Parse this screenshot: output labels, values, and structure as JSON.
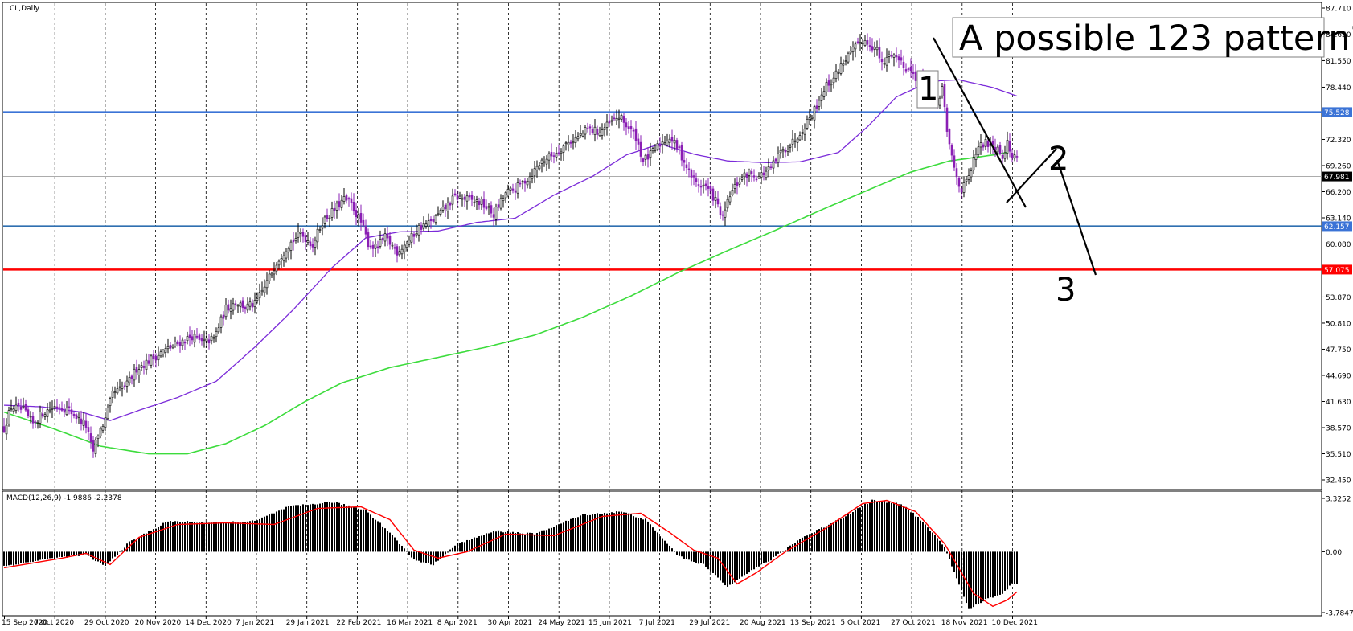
{
  "window": {
    "symbol_label": "CL,Daily",
    "macd_label": "MACD(12,26,9) -1.9886 -2.2378"
  },
  "annotations": {
    "title": "A possible 123 pattern?",
    "label_1": "1",
    "label_2": "2",
    "label_3": "3"
  },
  "colors": {
    "bull": "#000000",
    "bear": "#8a1fb5",
    "ma50": "#7b2bd9",
    "ma200": "#3ddc3d",
    "resistance": "#3b73d6",
    "support": "#2f6fb0",
    "target": "#ff0000",
    "macd_signal": "#ff0000",
    "grid": "#000000"
  },
  "chart_data": {
    "type": "candlestick",
    "price_axis": {
      "min": 32.45,
      "max": 87.71,
      "ticks": [
        "87.710",
        "84.650",
        "81.550",
        "78.440",
        "75.528",
        "72.320",
        "69.260",
        "67.981",
        "66.200",
        "63.140",
        "62.157",
        "60.080",
        "57.075",
        "53.870",
        "50.810",
        "47.750",
        "44.690",
        "41.630",
        "38.570",
        "35.510",
        "32.450"
      ],
      "tick_values": [
        87.71,
        84.65,
        81.55,
        78.44,
        75.528,
        72.32,
        69.26,
        67.981,
        66.2,
        63.14,
        62.157,
        60.08,
        57.075,
        53.87,
        50.81,
        47.75,
        44.69,
        41.63,
        38.57,
        35.51,
        32.45
      ]
    },
    "date_labels": [
      "15 Sep 2020",
      "7 Oct 2020",
      "29 Oct 2020",
      "20 Nov 2020",
      "14 Dec 2020",
      "7 Jan 2021",
      "29 Jan 2021",
      "22 Feb 2021",
      "16 Mar 2021",
      "8 Apr 2021",
      "30 Apr 2021",
      "24 May 2021",
      "15 Jun 2021",
      "7 Jul 2021",
      "29 Jul 2021",
      "20 Aug 2021",
      "13 Sep 2021",
      "5 Oct 2021",
      "27 Oct 2021",
      "18 Nov 2021",
      "10 Dec 2021"
    ],
    "horizontal_levels": [
      {
        "value": 75.528,
        "label": "75.528",
        "role": "resistance"
      },
      {
        "value": 62.157,
        "label": "62.157",
        "role": "support"
      },
      {
        "value": 57.075,
        "label": "57.075",
        "role": "target"
      },
      {
        "value": 67.981,
        "label": "67.981",
        "role": "current"
      }
    ],
    "price_anchors": [
      [
        0,
        38.5
      ],
      [
        3,
        41.0
      ],
      [
        8,
        40.6
      ],
      [
        12,
        39.0
      ],
      [
        16,
        40.3
      ],
      [
        22,
        41.2
      ],
      [
        27,
        40.6
      ],
      [
        31,
        39.6
      ],
      [
        34,
        38.8
      ],
      [
        36,
        36.5
      ],
      [
        37,
        35.8
      ],
      [
        39,
        37.8
      ],
      [
        42,
        39.5
      ],
      [
        45,
        42.5
      ],
      [
        48,
        43.0
      ],
      [
        51,
        43.6
      ],
      [
        55,
        45.5
      ],
      [
        60,
        46.4
      ],
      [
        66,
        47.5
      ],
      [
        72,
        48.4
      ],
      [
        78,
        49.3
      ],
      [
        82,
        48.5
      ],
      [
        87,
        49.0
      ],
      [
        92,
        52.5
      ],
      [
        96,
        53.3
      ],
      [
        100,
        52.7
      ],
      [
        104,
        53.0
      ],
      [
        108,
        55.0
      ],
      [
        113,
        58.0
      ],
      [
        118,
        60.0
      ],
      [
        123,
        61.3
      ],
      [
        128,
        60.0
      ],
      [
        132,
        62.7
      ],
      [
        136,
        63.8
      ],
      [
        141,
        65.3
      ],
      [
        144,
        64.7
      ],
      [
        148,
        62.6
      ],
      [
        151,
        60.2
      ],
      [
        154,
        59.6
      ],
      [
        158,
        60.8
      ],
      [
        163,
        59.2
      ],
      [
        168,
        60.5
      ],
      [
        172,
        62.0
      ],
      [
        177,
        62.6
      ],
      [
        182,
        64.0
      ],
      [
        187,
        65.6
      ],
      [
        192,
        65.3
      ],
      [
        198,
        64.9
      ],
      [
        203,
        63.5
      ],
      [
        208,
        66.0
      ],
      [
        212,
        66.5
      ],
      [
        218,
        68.0
      ],
      [
        223,
        69.8
      ],
      [
        228,
        70.6
      ],
      [
        233,
        71.8
      ],
      [
        238,
        72.6
      ],
      [
        242,
        73.5
      ],
      [
        247,
        73.2
      ],
      [
        250,
        73.9
      ],
      [
        255,
        75.0
      ],
      [
        258,
        74.0
      ],
      [
        262,
        72.6
      ],
      [
        265,
        69.8
      ],
      [
        268,
        70.5
      ],
      [
        272,
        71.8
      ],
      [
        276,
        72.6
      ],
      [
        280,
        71.0
      ],
      [
        284,
        68.5
      ],
      [
        287,
        67.2
      ],
      [
        291,
        66.8
      ],
      [
        295,
        65.2
      ],
      [
        298,
        63.0
      ],
      [
        301,
        65.8
      ],
      [
        305,
        67.6
      ],
      [
        309,
        68.4
      ],
      [
        313,
        68.0
      ],
      [
        318,
        68.9
      ],
      [
        322,
        70.8
      ],
      [
        327,
        72.0
      ],
      [
        332,
        74.0
      ],
      [
        336,
        75.8
      ],
      [
        340,
        78.3
      ],
      [
        344,
        79.5
      ],
      [
        348,
        81.5
      ],
      [
        352,
        82.7
      ],
      [
        356,
        84.0
      ],
      [
        359,
        83.5
      ],
      [
        362,
        82.8
      ],
      [
        364,
        81.0
      ],
      [
        368,
        82.5
      ],
      [
        372,
        81.4
      ],
      [
        377,
        80.0
      ],
      [
        381,
        78.6
      ],
      [
        385,
        78.0
      ],
      [
        387,
        76.5
      ],
      [
        389,
        78.4
      ],
      [
        391,
        73.0
      ],
      [
        394,
        69.0
      ],
      [
        397,
        66.3
      ],
      [
        400,
        67.8
      ],
      [
        403,
        70.8
      ],
      [
        406,
        71.8
      ],
      [
        409,
        72.0
      ],
      [
        412,
        71.4
      ],
      [
        414,
        70.5
      ],
      [
        416,
        71.9
      ],
      [
        418,
        70.2
      ],
      [
        420,
        70.4
      ]
    ],
    "ma50_anchors": [
      [
        0,
        41.2
      ],
      [
        16,
        41.0
      ],
      [
        32,
        40.4
      ],
      [
        44,
        39.4
      ],
      [
        56,
        40.6
      ],
      [
        72,
        42.1
      ],
      [
        88,
        44.0
      ],
      [
        104,
        48.0
      ],
      [
        120,
        52.4
      ],
      [
        136,
        57.3
      ],
      [
        150,
        60.8
      ],
      [
        164,
        61.5
      ],
      [
        180,
        61.6
      ],
      [
        196,
        62.6
      ],
      [
        212,
        63.1
      ],
      [
        228,
        65.8
      ],
      [
        244,
        68.0
      ],
      [
        258,
        70.5
      ],
      [
        272,
        71.8
      ],
      [
        286,
        70.6
      ],
      [
        300,
        69.8
      ],
      [
        316,
        69.6
      ],
      [
        330,
        69.7
      ],
      [
        346,
        70.8
      ],
      [
        358,
        73.8
      ],
      [
        370,
        77.3
      ],
      [
        380,
        78.6
      ],
      [
        388,
        79.2
      ],
      [
        396,
        79.3
      ],
      [
        410,
        78.4
      ],
      [
        420,
        77.4
      ]
    ],
    "ma200_anchors": [
      [
        0,
        40.4
      ],
      [
        20,
        38.5
      ],
      [
        40,
        36.4
      ],
      [
        60,
        35.5
      ],
      [
        76,
        35.5
      ],
      [
        92,
        36.7
      ],
      [
        108,
        38.8
      ],
      [
        124,
        41.5
      ],
      [
        140,
        43.8
      ],
      [
        160,
        45.6
      ],
      [
        180,
        46.8
      ],
      [
        200,
        48.0
      ],
      [
        220,
        49.4
      ],
      [
        240,
        51.5
      ],
      [
        260,
        54.0
      ],
      [
        280,
        56.8
      ],
      [
        300,
        59.3
      ],
      [
        320,
        61.7
      ],
      [
        340,
        64.2
      ],
      [
        360,
        66.6
      ],
      [
        376,
        68.5
      ],
      [
        392,
        69.8
      ],
      [
        410,
        70.5
      ],
      [
        416,
        70.8
      ]
    ],
    "macd_axis": {
      "min": -3.7847,
      "max": 3.3252,
      "ticks": [
        "3.3252",
        "0.00",
        "-3.7847"
      ],
      "tick_values": [
        3.3252,
        0,
        -3.7847
      ]
    },
    "macd_anchors": [
      [
        0,
        -0.9
      ],
      [
        20,
        -0.4
      ],
      [
        34,
        -0.2
      ],
      [
        42,
        -0.9
      ],
      [
        52,
        0.6
      ],
      [
        68,
        1.9
      ],
      [
        88,
        1.8
      ],
      [
        104,
        1.9
      ],
      [
        118,
        2.8
      ],
      [
        136,
        3.1
      ],
      [
        150,
        2.6
      ],
      [
        160,
        1.2
      ],
      [
        170,
        -0.5
      ],
      [
        178,
        -0.8
      ],
      [
        188,
        0.5
      ],
      [
        204,
        1.3
      ],
      [
        220,
        1.1
      ],
      [
        240,
        2.3
      ],
      [
        256,
        2.5
      ],
      [
        266,
        2.0
      ],
      [
        272,
        1.0
      ],
      [
        280,
        -0.3
      ],
      [
        290,
        -0.8
      ],
      [
        300,
        -2.2
      ],
      [
        306,
        -1.5
      ],
      [
        318,
        -0.5
      ],
      [
        330,
        0.8
      ],
      [
        346,
        2.0
      ],
      [
        360,
        3.2
      ],
      [
        372,
        3.0
      ],
      [
        380,
        2.0
      ],
      [
        390,
        0.3
      ],
      [
        400,
        -3.6
      ],
      [
        408,
        -2.9
      ],
      [
        414,
        -2.6
      ],
      [
        418,
        -2.0
      ]
    ],
    "signal_anchors": [
      [
        0,
        -1.0
      ],
      [
        24,
        -0.4
      ],
      [
        34,
        -0.1
      ],
      [
        44,
        -0.8
      ],
      [
        56,
        0.9
      ],
      [
        72,
        1.7
      ],
      [
        92,
        1.8
      ],
      [
        112,
        1.7
      ],
      [
        130,
        2.7
      ],
      [
        148,
        2.8
      ],
      [
        160,
        2.0
      ],
      [
        170,
        0.1
      ],
      [
        180,
        -0.4
      ],
      [
        192,
        0.0
      ],
      [
        208,
        1.1
      ],
      [
        228,
        1.0
      ],
      [
        248,
        2.2
      ],
      [
        264,
        2.4
      ],
      [
        276,
        1.2
      ],
      [
        286,
        0.1
      ],
      [
        296,
        -0.4
      ],
      [
        304,
        -2.0
      ],
      [
        312,
        -1.3
      ],
      [
        324,
        0.0
      ],
      [
        340,
        1.4
      ],
      [
        356,
        3.0
      ],
      [
        366,
        3.2
      ],
      [
        378,
        2.5
      ],
      [
        390,
        0.5
      ],
      [
        402,
        -2.6
      ],
      [
        410,
        -3.4
      ],
      [
        416,
        -3.0
      ],
      [
        420,
        -2.5
      ]
    ]
  }
}
